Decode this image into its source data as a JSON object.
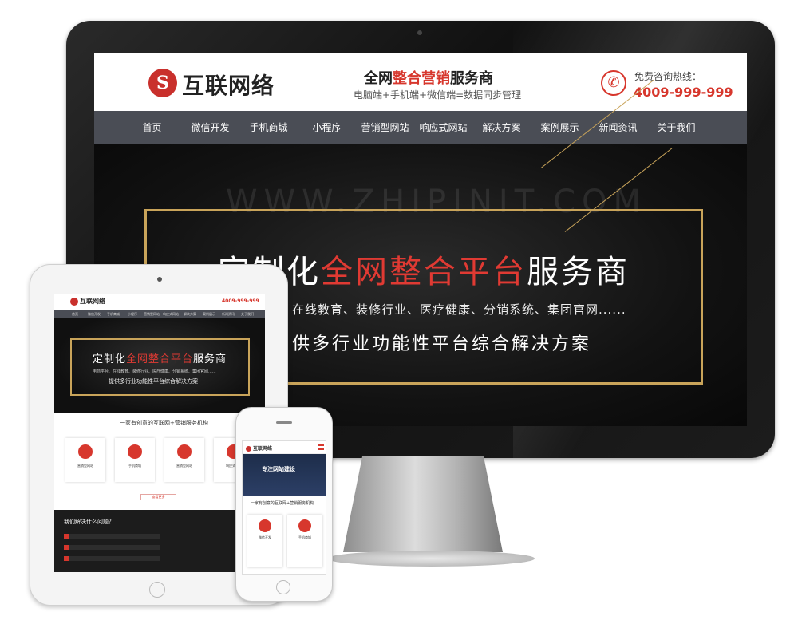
{
  "desktop": {
    "logo_glyph": "S",
    "logo_text": "互联网络",
    "slogan_pre": "全网",
    "slogan_hl": "整合营销",
    "slogan_post": "服务商",
    "subslogan": "电脑端+手机端+微信端=数据同步管理",
    "hotline_label": "免费咨询热线：",
    "hotline_number": "4009-999-999",
    "nav": [
      "首页",
      "微信开发",
      "手机商城",
      "小程序",
      "营销型网站",
      "响应式网站",
      "解决方案",
      "案例展示",
      "新闻资讯",
      "关于我们"
    ],
    "watermark": "WWW.ZHIPINIT.COM",
    "hero_title_pre": "定制化",
    "hero_title_hl": "全网整合平台",
    "hero_title_post": "服务商",
    "hero_line1": "在线教育、装修行业、医疗健康、分销系统、集团官网......",
    "hero_line2": "供多行业功能性平台综合解决方案"
  },
  "tablet": {
    "logo_text": "互联网络",
    "phone": "4009-999-999",
    "nav": [
      "首页",
      "微信开发",
      "手机商城",
      "小程序",
      "营销型网站",
      "响应式网站",
      "解决方案",
      "案例展示",
      "新闻资讯",
      "关于我们"
    ],
    "hero_title_pre": "定制化",
    "hero_title_hl": "全网整合平台",
    "hero_title_post": "服务商",
    "hero_sub1": "电商平台、在线教育、装修行业、医疗健康、分销系统、集团官网......",
    "hero_sub2": "提供多行业功能性平台综合解决方案",
    "section_title": "一家有创意的互联网+营销服务机构",
    "cards": [
      "营销型网站",
      "手机商城",
      "营销型网站",
      "响应式网站"
    ],
    "more": "查看更多",
    "dark_title": "我们解决什么问题？"
  },
  "phone": {
    "logo_text": "互联网络",
    "hero_title": "专注网站建设",
    "section_title": "一家有创意的互联网+营销服务机构",
    "cards": [
      "微信开发",
      "手机商城"
    ]
  },
  "colors": {
    "accent": "#d7372d",
    "nav_bg": "#4a4d55",
    "gold": "#c9a45a"
  }
}
